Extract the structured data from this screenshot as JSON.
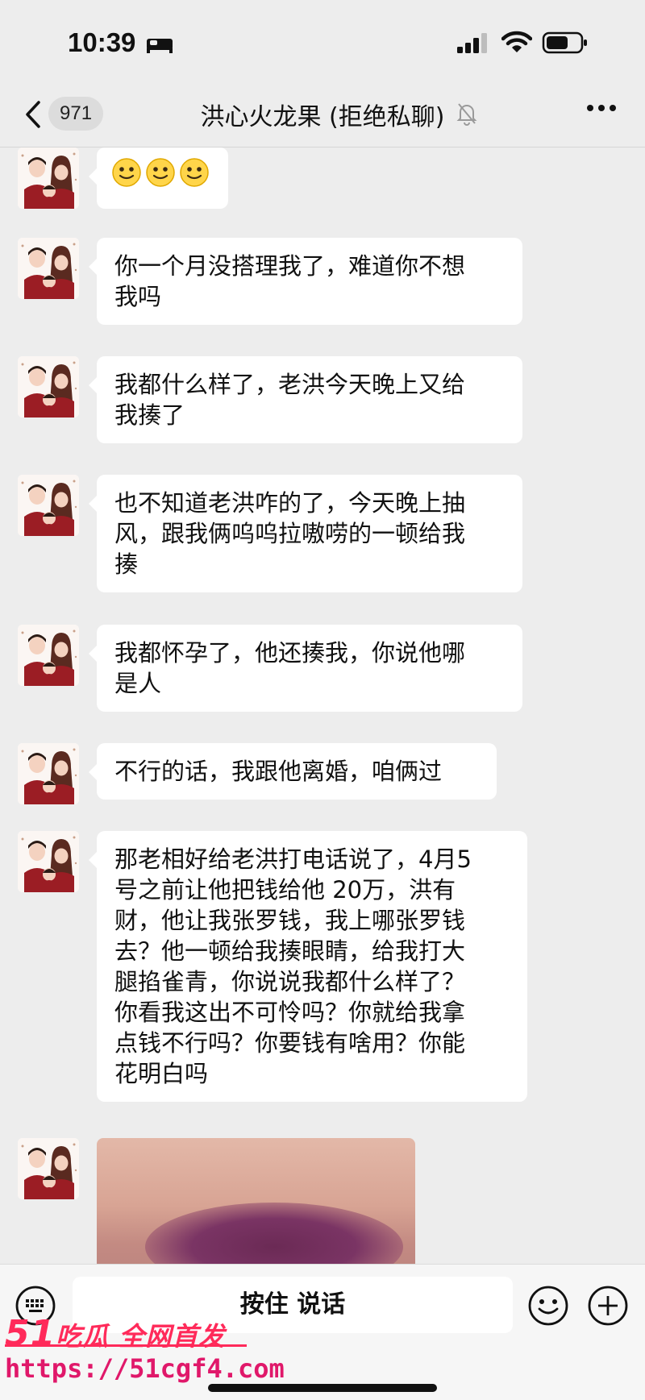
{
  "status_bar": {
    "time": "10:39"
  },
  "nav": {
    "unread_count": "971",
    "title": "洪心火龙果 (拒绝私聊)"
  },
  "messages": [
    {
      "type": "emoji",
      "emojis": [
        "🙂",
        "🙂",
        "🙂"
      ]
    },
    {
      "type": "text",
      "lines": [
        "你一个月没搭理我了，难道你不想",
        "我吗"
      ]
    },
    {
      "type": "text",
      "lines": [
        "我都什么样了，老洪今天晚上又给",
        "我揍了"
      ]
    },
    {
      "type": "text",
      "lines": [
        "也不知道老洪咋的了，今天晚上抽",
        "风，跟我俩呜呜拉嗷唠的一顿给我",
        "揍"
      ]
    },
    {
      "type": "text",
      "lines": [
        "我都怀孕了，他还揍我，你说他哪",
        "是人"
      ]
    },
    {
      "type": "text",
      "lines": [
        "不行的话，我跟他离婚，咱俩过"
      ]
    },
    {
      "type": "text",
      "lines": [
        "那老相好给老洪打电话说了，4月5",
        "号之前让他把钱给他 20万，洪有",
        "财，他让我张罗钱，我上哪张罗钱",
        "去？他一顿给我揍眼睛，给我打大",
        "腿掐雀青，你说说我都什么样了？",
        "你看我这出不可怜吗？你就给我拿",
        "点钱不行吗？你要钱有啥用？你能",
        "花明白吗"
      ]
    },
    {
      "type": "photo"
    }
  ],
  "input_bar": {
    "hold_to_talk": "按住 说话"
  },
  "watermark": {
    "brand_num": "51",
    "brand_text": "吃瓜 全网首发",
    "url": "https://51cgf4.com"
  },
  "colors": {
    "background": "#ededed",
    "bubble": "#ffffff",
    "watermark": "#ff2a5a"
  }
}
